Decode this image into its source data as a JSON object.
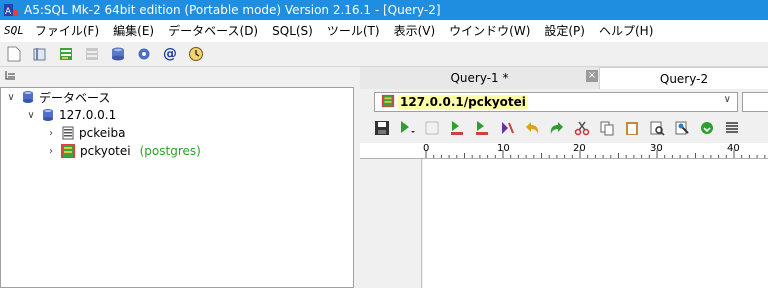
{
  "window": {
    "title": "A5:SQL Mk-2 64bit edition (Portable mode) Version 2.16.1 - [Query-2]"
  },
  "menubar": {
    "sql_badge": "SQL",
    "items": [
      "ファイル(F)",
      "編集(E)",
      "データベース(D)",
      "SQL(S)",
      "ツール(T)",
      "表示(V)",
      "ウインドウ(W)",
      "設定(P)",
      "ヘルプ(H)"
    ]
  },
  "toolbar": {
    "icons": [
      "new-file-icon",
      "open-icon",
      "table-editor-icon",
      "table-icon-disabled",
      "db-connect-icon",
      "settings-icon",
      "at-icon",
      "clock-icon"
    ],
    "at_symbol": "@"
  },
  "tree": {
    "root_label": "データベース",
    "server_label": "127.0.0.1",
    "databases": [
      {
        "name": "pckeiba",
        "tag": ""
      },
      {
        "name": "pckyotei",
        "tag": "(postgres)"
      }
    ]
  },
  "tabs": [
    {
      "label": "Query-1 *",
      "active": false
    },
    {
      "label": "Query-2",
      "active": true
    }
  ],
  "tab_close_glyph": "×",
  "connection": {
    "selected": "127.0.0.1/pckyotei"
  },
  "ruler": {
    "labels": [
      "0",
      "10",
      "20",
      "30",
      "40"
    ]
  },
  "colors": {
    "titlebar": "#1f8ee0",
    "highlight": "#ffffa6",
    "pg_tag": "#2e9f2e"
  }
}
